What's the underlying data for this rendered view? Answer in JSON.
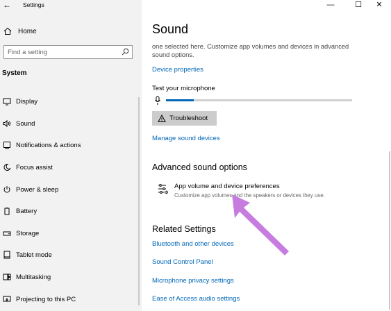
{
  "window": {
    "title": "Settings",
    "back_glyph": "←",
    "minimize_glyph": "—",
    "maximize_glyph": "☐",
    "close_glyph": "✕"
  },
  "sidebar": {
    "home_label": "Home",
    "search_placeholder": "Find a setting",
    "section_label": "System",
    "items": [
      {
        "label": "Display",
        "icon": "monitor-icon"
      },
      {
        "label": "Sound",
        "icon": "speaker-icon"
      },
      {
        "label": "Notifications & actions",
        "icon": "notification-icon"
      },
      {
        "label": "Focus assist",
        "icon": "moon-icon"
      },
      {
        "label": "Power & sleep",
        "icon": "power-icon"
      },
      {
        "label": "Battery",
        "icon": "battery-icon"
      },
      {
        "label": "Storage",
        "icon": "storage-icon"
      },
      {
        "label": "Tablet mode",
        "icon": "tablet-icon"
      },
      {
        "label": "Multitasking",
        "icon": "multitasking-icon"
      },
      {
        "label": "Projecting to this PC",
        "icon": "projecting-icon"
      }
    ]
  },
  "main": {
    "title": "Sound",
    "description": "one selected here. Customize app volumes and devices in advanced sound options.",
    "device_properties_link": "Device properties",
    "test_mic_label": "Test your microphone",
    "mic_level": 0.15,
    "troubleshoot_label": "Troubleshoot",
    "manage_devices_link": "Manage sound devices",
    "advanced_heading": "Advanced sound options",
    "app_volume_title": "App volume and device preferences",
    "app_volume_desc": "Customize app volumes and the speakers or devices they use.",
    "related_heading": "Related Settings",
    "related_links": [
      "Bluetooth and other devices",
      "Sound Control Panel",
      "Microphone privacy settings",
      "Ease of Access audio settings"
    ]
  },
  "colors": {
    "link": "#0067b8",
    "annotation_arrow": "#c77de0"
  }
}
